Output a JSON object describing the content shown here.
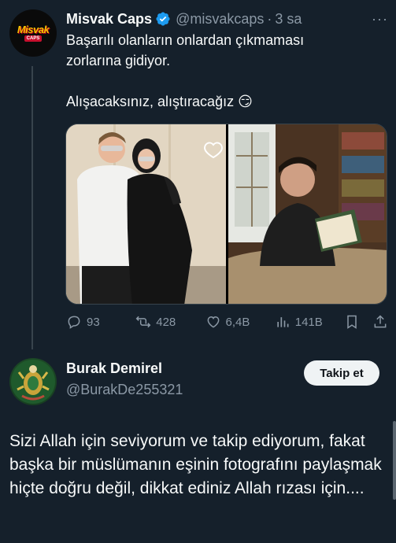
{
  "tweet": {
    "author": {
      "name": "Misvak Caps",
      "handle": "@misvakcaps",
      "avatar_text": "Misvak",
      "avatar_subtext": "CAPS",
      "verified_color": "#1d9bf0"
    },
    "separator": "·",
    "time": "3 sa",
    "more_label": "···",
    "text_lines": [
      "Başarılı olanların onlardan çıkmaması",
      "zorlarına gidiyor.",
      "Alışacaksınız, alıştıracağız 😏"
    ],
    "media": [
      {
        "name": "left-photo",
        "icon": "heart-outline-icon"
      },
      {
        "name": "right-photo"
      }
    ],
    "actions": {
      "replies": "93",
      "retweets": "428",
      "likes": "6,4B",
      "views": "141B"
    }
  },
  "reply": {
    "author": {
      "name": "Burak Demirel",
      "handle": "@BurakDe255321"
    },
    "follow_label": "Takip et",
    "text": "Sizi Allah için seviyorum ve takip ediyorum, fakat başka bir müslümanın eşinin fotografını paylaşmak hiçte doğru değil, dikkat ediniz Allah rızası için...."
  },
  "colors": {
    "background": "#15202b",
    "text": "#f7f9f9",
    "muted": "#8b98a5",
    "accent": "#1d9bf0"
  }
}
